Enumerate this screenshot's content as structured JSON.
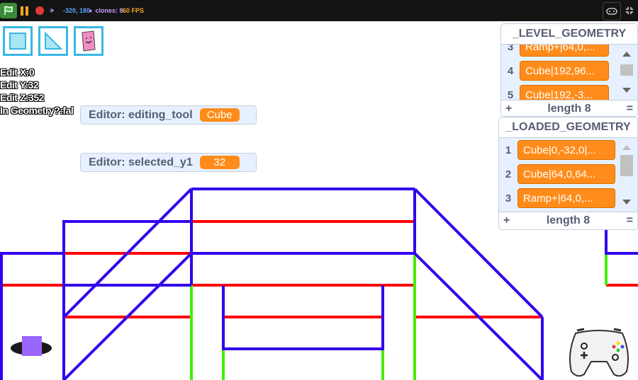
{
  "topbar": {
    "coords": "-320, 180",
    "clones": "clones: 8",
    "fps": "60 FPS"
  },
  "editor": {
    "lines": [
      "Edit X:0",
      "Edit Y:32",
      "Edit Z:352",
      "In Geometry?:fal"
    ],
    "watchers": [
      {
        "label": "Editor: editing_tool",
        "value": "Cube"
      },
      {
        "label": "Editor: selected_y1",
        "value": "32"
      }
    ]
  },
  "lists": {
    "level": {
      "title": "_LEVEL_GEOMETRY",
      "rows": [
        {
          "index": "3",
          "value": "Ramp+|64,0,..."
        },
        {
          "index": "4",
          "value": "Cube|192,96..."
        },
        {
          "index": "5",
          "value": "Cube|192,-3..."
        }
      ],
      "length": "length 8"
    },
    "loaded": {
      "title": "_LOADED_GEOMETRY",
      "rows": [
        {
          "index": "1",
          "value": "Cube|0,-32,0|..."
        },
        {
          "index": "2",
          "value": "Cube|64,0,64..."
        },
        {
          "index": "3",
          "value": "Ramp+|64,0,..."
        }
      ],
      "length": "length 8"
    }
  },
  "footer_add": "+",
  "footer_eq": "=",
  "colors": {
    "edge_blue": "#3300ee",
    "edge_red": "#ff0000",
    "edge_green": "#44ee00",
    "accent": "#ff8c1a"
  }
}
